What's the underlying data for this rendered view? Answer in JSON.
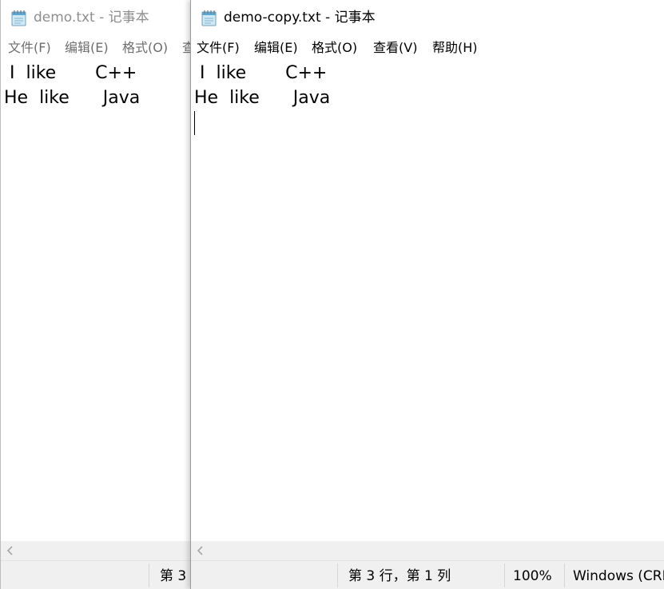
{
  "back_window": {
    "title": "demo.txt - 记事本",
    "menu": [
      "文件(F)",
      "编辑(E)",
      "格式(O)",
      "查"
    ],
    "lines": [
      " I  like       C++",
      "He  like      Java"
    ],
    "status_position": "第 3"
  },
  "front_window": {
    "title": "demo-copy.txt - 记事本",
    "menu": [
      "文件(F)",
      "编辑(E)",
      "格式(O)",
      "查看(V)",
      "帮助(H)"
    ],
    "lines": [
      " I  like       C++",
      "He  like      Java"
    ],
    "status": {
      "position": "第 3 行，第 1 列",
      "zoom": "100%",
      "line_ending": "Windows (CRLF)"
    }
  },
  "icons": {
    "notepad": "notepad-icon",
    "scroll_left": "scroll-left-arrow-icon"
  },
  "colors": {
    "status_bar": "#f0f0f0",
    "scrollbar": "#f0f0f0",
    "inactive_text": "#8e8e8e"
  }
}
